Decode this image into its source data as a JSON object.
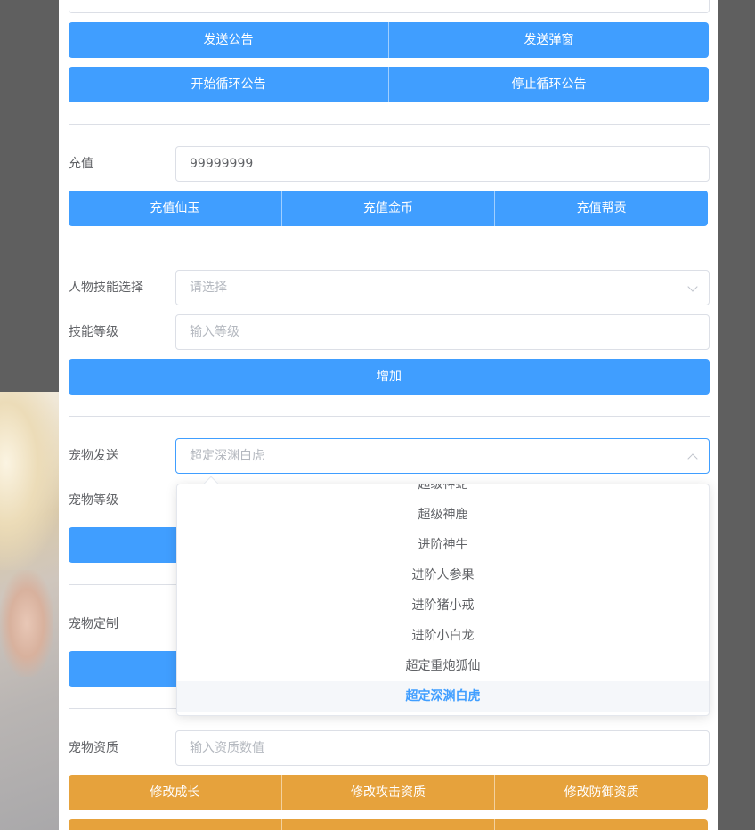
{
  "announcement": {
    "buttons_row1": [
      "发送公告",
      "发送弹窗"
    ],
    "buttons_row2": [
      "开始循环公告",
      "停止循环公告"
    ]
  },
  "recharge": {
    "label": "充值",
    "value": "99999999",
    "buttons": [
      "充值仙玉",
      "充值金币",
      "充值帮贡"
    ]
  },
  "skill": {
    "select_label": "人物技能选择",
    "select_placeholder": "请选择",
    "level_label": "技能等级",
    "level_placeholder": "输入等级",
    "add_button": "增加"
  },
  "pet_send": {
    "label": "宠物发送",
    "selected": "超定深渊白虎",
    "level_label": "宠物等级",
    "options": [
      "超级神蛇",
      "超级神鹿",
      "进阶神牛",
      "进阶人参果",
      "进阶猪小戒",
      "进阶小白龙",
      "超定重炮狐仙",
      "超定深渊白虎"
    ]
  },
  "pet_custom": {
    "label": "宠物定制"
  },
  "pet_quality": {
    "label": "宠物资质",
    "placeholder": "输入资质数值",
    "buttons": [
      "修改成长",
      "修改攻击资质",
      "修改防御资质"
    ]
  },
  "colors": {
    "primary": "#409eff",
    "warning": "#e6a23c",
    "background": "#5f5f5f"
  }
}
